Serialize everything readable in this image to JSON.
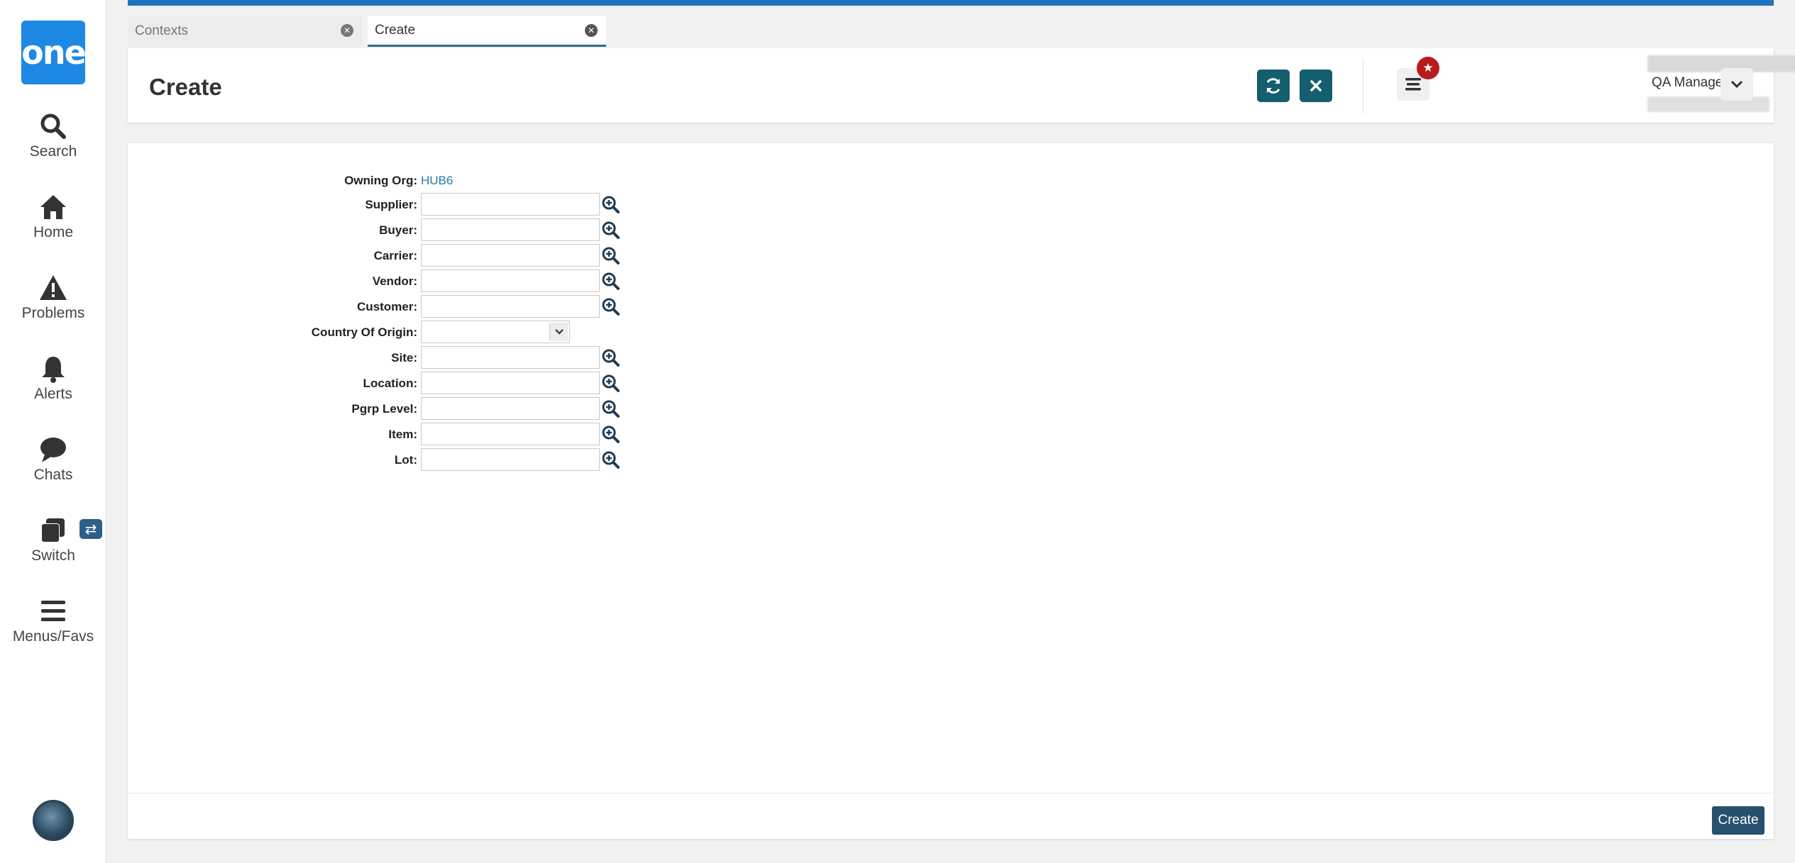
{
  "app": {
    "logo_text": "one"
  },
  "sidebar": {
    "items": [
      {
        "label": "Search",
        "icon": "search-icon"
      },
      {
        "label": "Home",
        "icon": "home-icon"
      },
      {
        "label": "Problems",
        "icon": "warning-icon"
      },
      {
        "label": "Alerts",
        "icon": "bell-icon"
      },
      {
        "label": "Chats",
        "icon": "chat-icon"
      },
      {
        "label": "Switch",
        "icon": "switch-icon"
      },
      {
        "label": "Menus/Favs",
        "icon": "hamburger-icon"
      }
    ],
    "switch_badge": "⇄"
  },
  "tabs": [
    {
      "label": "Contexts",
      "active": false
    },
    {
      "label": "Create",
      "active": true
    }
  ],
  "header": {
    "title": "Create",
    "user_role": "QA Manager",
    "colors": {
      "action_button": "#155e6e",
      "badge": "#b71c1c",
      "top_bar": "#1e73be"
    }
  },
  "form": {
    "owning_org": {
      "label": "Owning Org:",
      "value": "HUB6"
    },
    "fields": [
      {
        "label": "Supplier:",
        "value": ""
      },
      {
        "label": "Buyer:",
        "value": ""
      },
      {
        "label": "Carrier:",
        "value": ""
      },
      {
        "label": "Vendor:",
        "value": ""
      },
      {
        "label": "Customer:",
        "value": ""
      }
    ],
    "country": {
      "label": "Country Of Origin:",
      "value": ""
    },
    "fields2": [
      {
        "label": "Site:",
        "value": ""
      },
      {
        "label": "Location:",
        "value": ""
      },
      {
        "label": "Pgrp Level:",
        "value": ""
      },
      {
        "label": "Item:",
        "value": ""
      },
      {
        "label": "Lot:",
        "value": ""
      }
    ]
  },
  "footer": {
    "create_label": "Create"
  }
}
